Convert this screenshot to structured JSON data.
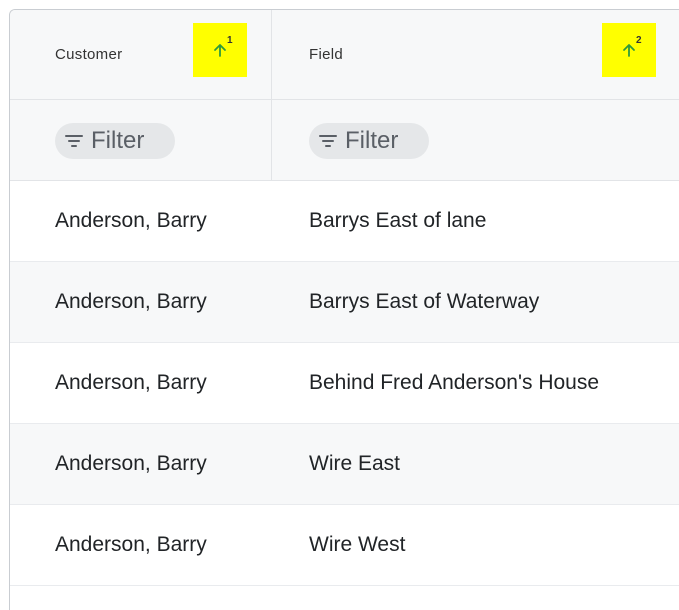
{
  "columns": [
    {
      "header": "Customer",
      "sort_order": "1",
      "sort_icon": "arrow-up-icon",
      "filter_label": "Filter",
      "filter_icon": "filter-lines-icon"
    },
    {
      "header": "Field",
      "sort_order": "2",
      "sort_icon": "arrow-up-icon",
      "filter_label": "Filter",
      "filter_icon": "filter-lines-icon"
    }
  ],
  "rows": [
    {
      "customer": "Anderson, Barry",
      "field": "Barrys East of lane"
    },
    {
      "customer": "Anderson, Barry",
      "field": "Barrys East of Waterway"
    },
    {
      "customer": "Anderson, Barry",
      "field": "Behind Fred Anderson's House"
    },
    {
      "customer": "Anderson, Barry",
      "field": "Wire East"
    },
    {
      "customer": "Anderson, Barry",
      "field": "Wire West"
    }
  ],
  "colors": {
    "sort_highlight": "#ffff00",
    "sort_arrow": "#2e9a3c",
    "header_bg": "#f7f8f9",
    "chip_bg": "#e5e7e9"
  }
}
